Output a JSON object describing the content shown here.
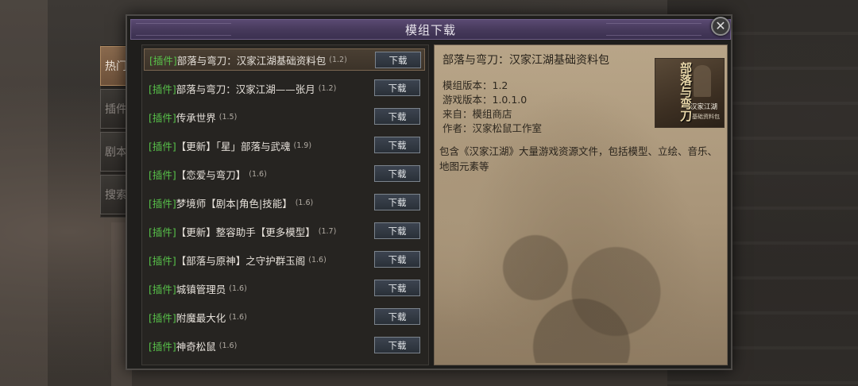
{
  "dialog": {
    "title": "模组下载",
    "close_glyph": "✕"
  },
  "tabs": [
    {
      "label": "热门",
      "active": true
    },
    {
      "label": "插件",
      "active": false
    },
    {
      "label": "剧本",
      "active": false
    },
    {
      "label": "搜索",
      "active": false
    }
  ],
  "list": {
    "button_label": "下载",
    "items": [
      {
        "tag": "[插件]",
        "name": "部落与弯刀：汉家江湖基础资料包",
        "ver": "(1.2)",
        "selected": true
      },
      {
        "tag": "[插件]",
        "name": "部落与弯刀：汉家江湖——张月",
        "ver": "(1.2)"
      },
      {
        "tag": "[插件]",
        "name": "传承世界",
        "ver": "(1.5)"
      },
      {
        "tag": "[插件]",
        "name": "【更新】「星」部落与武魂",
        "ver": "(1.9)"
      },
      {
        "tag": "[插件]",
        "name": "【恋爱与弯刀】",
        "ver": "(1.6)"
      },
      {
        "tag": "[插件]",
        "name": "梦境师【剧本|角色|技能】",
        "ver": "(1.6)"
      },
      {
        "tag": "[插件]",
        "name": "【更新】整容助手【更多模型】",
        "ver": "(1.7)"
      },
      {
        "tag": "[插件]",
        "name": "【部落与原神】之守护群玉阁",
        "ver": "(1.6)"
      },
      {
        "tag": "[插件]",
        "name": "城镇管理员",
        "ver": "(1.6)"
      },
      {
        "tag": "[插件]",
        "name": "附魔最大化",
        "ver": "(1.6)"
      },
      {
        "tag": "[插件]",
        "name": "神奇松鼠",
        "ver": "(1.6)"
      }
    ]
  },
  "detail": {
    "title": "部落与弯刀：汉家江湖基础资料包",
    "mod_version": "模组版本：1.2",
    "game_version": "游戏版本：1.0.1.0",
    "source": "来自：模组商店",
    "author": "作者：汉家松鼠工作室",
    "description": "包含《汉家江湖》大量游戏资源文件，包括模型、立绘、音乐、地图元素等",
    "thumb": {
      "title": "部落与弯刀",
      "subtitle": "汉家江湖",
      "caption": "基础资料包"
    }
  }
}
